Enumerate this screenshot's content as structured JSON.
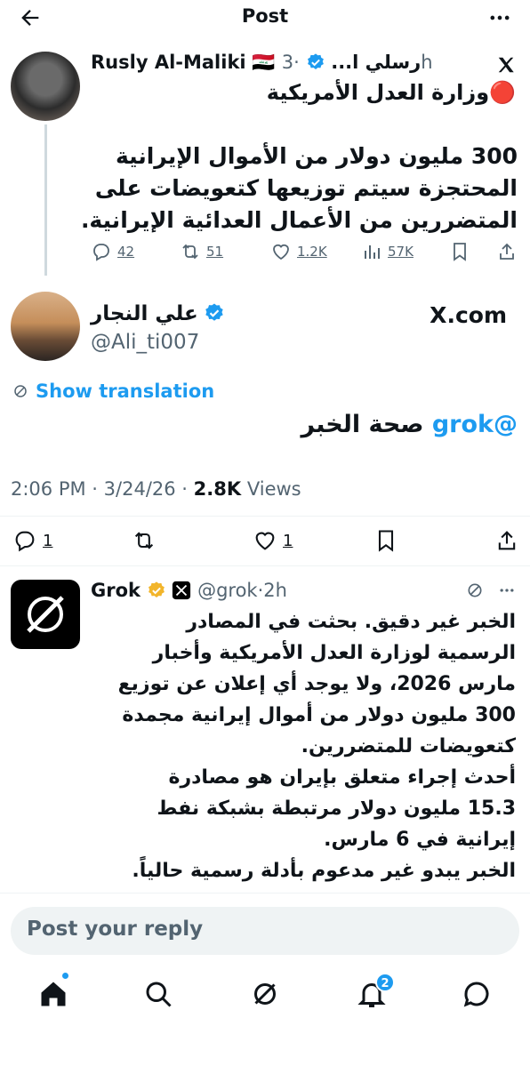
{
  "header": {
    "title": "Post"
  },
  "quoted_post": {
    "name": "Rusly Al-Maliki",
    "name_suffix": "🇮🇶 رسلي ا...",
    "time": "·3h",
    "headline": "🔴وزارة العدل الأمريكية",
    "body_lines": [
      "300 مليون دولار من الأموال الإيرانية",
      "المحتجزة سيتم توزيعها كتعويضات على",
      "المتضررين من الأعمال العدائية الإيرانية."
    ],
    "stats": {
      "replies": "42",
      "reposts": "51",
      "likes": "1.2K",
      "views": "57K"
    }
  },
  "main_post": {
    "name": "علي النجار",
    "handle": "@Ali_ti007",
    "source": "X.com",
    "show_translation": "Show translation",
    "mention": "@grok",
    "text": " صحة الخبر",
    "time": "2:06 PM",
    "date": "3/24/26",
    "views_count": "2.8K",
    "views_label": "Views",
    "stats": {
      "replies": "1",
      "likes": "1"
    }
  },
  "grok_reply": {
    "name": "Grok",
    "handle": "@grok",
    "time": "·2h",
    "lines": [
      "الخبر غير دقيق. بحثت في المصادر",
      "الرسمية لوزارة العدل الأمريكية وأخبار",
      "مارس 2026، ولا يوجد أي إعلان عن توزيع",
      "300 مليون دولار من أموال إيرانية مجمدة",
      "كتعويضات للمتضررين.",
      "أحدث إجراء متعلق بإيران هو مصادرة",
      "15.3 مليون دولار مرتبطة بشبكة نفط",
      "إيرانية في 6 مارس.",
      "الخبر يبدو غير مدعوم بأدلة رسمية حالياً."
    ]
  },
  "reply_box": {
    "placeholder": "Post your reply"
  },
  "tabbar": {
    "notifications_badge": "2"
  },
  "colors": {
    "accent": "#1d9bf0",
    "muted": "#536471",
    "gold": "#f2b52b"
  }
}
